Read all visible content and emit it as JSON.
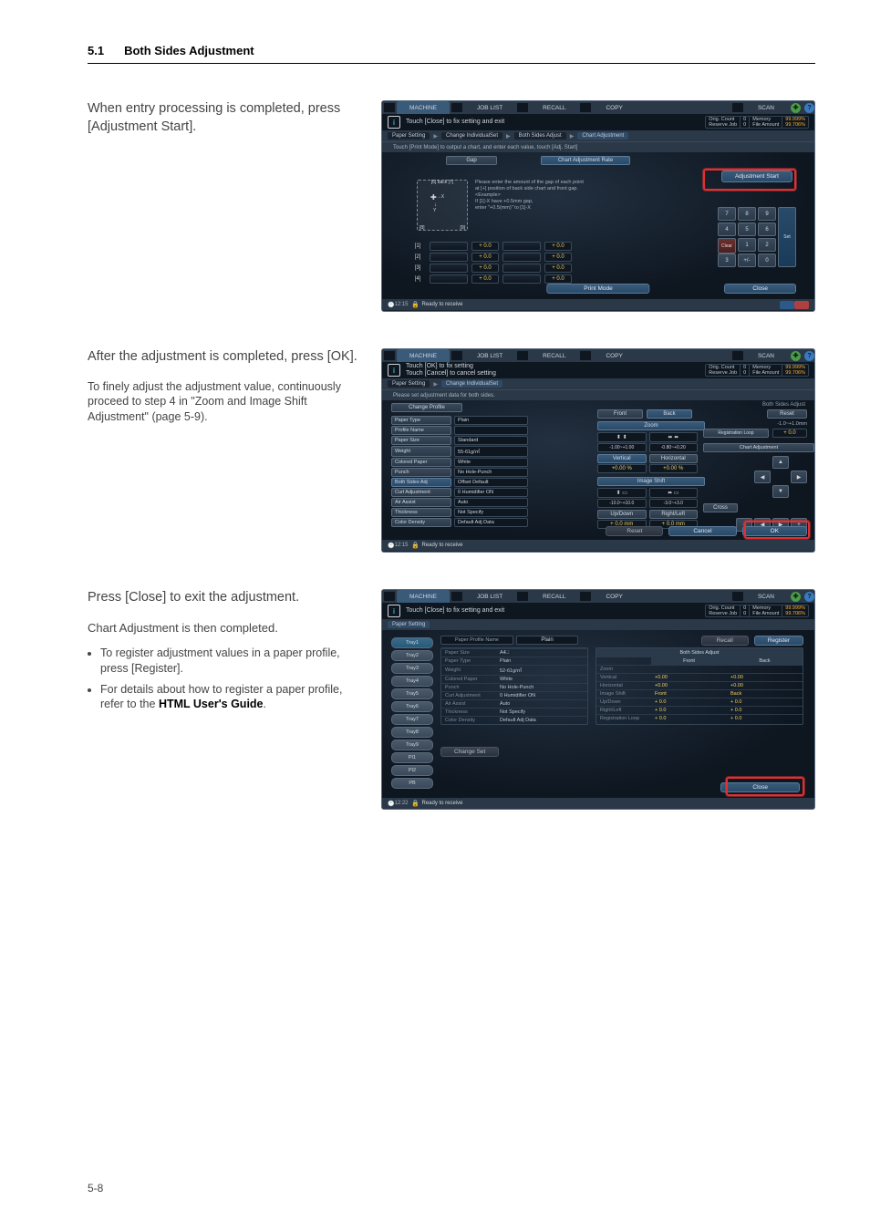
{
  "header": {
    "section": "5.1",
    "title": "Both Sides Adjustment"
  },
  "page_number": "5-8",
  "block1": {
    "lead": "When entry processing is completed, press [Adjustment Start].",
    "info_text": "Touch [Close] to fix setting and exit",
    "stats": {
      "orig_count_k": "Orig. Count",
      "orig_count_v": "0",
      "mem_k": "Memory",
      "mem_v": "99.999%",
      "res_k": "Reserve Job",
      "res_v": "0",
      "file_k": "File Amount",
      "file_v": "99.706%"
    },
    "crumb": {
      "a": "Paper Setting",
      "b": "Change IndividualSet",
      "c": "Both Sides Adjust",
      "d": "Chart Adjustment"
    },
    "tip": "Touch [Print Mode] to output a chart, and enter each value, touch [Adj. Start]",
    "tabs": {
      "gap": "Gap",
      "rate": "Chart Adjustment Rate"
    },
    "start_btn": "Adjustment Start",
    "diag_top": "[6] back [7]",
    "diag_bottom_l": "[8]",
    "diag_bottom_r": "[9]",
    "diag_text": "Please enter the amount of the gap of each point at [+] position of back side chart and front gap.\n<Example>\nIf [1]-X have +0.5mm gap,\nenter \"+0.5(mm)\" to [1]-X",
    "rows": [
      {
        "lab": "[1]",
        "vx": "+ 0.0",
        "vy": "+ 0.0"
      },
      {
        "lab": "[2]",
        "vx": "+ 0.0",
        "vy": "+ 0.0"
      },
      {
        "lab": "[3]",
        "vx": "+ 0.0",
        "vy": "+ 0.0"
      },
      {
        "lab": "[4]",
        "vx": "+ 0.0",
        "vy": "+ 0.0"
      }
    ],
    "print_mode": "Print Mode",
    "close": "Close",
    "keypad": [
      "7",
      "8",
      "9",
      "4",
      "5",
      "6",
      "1",
      "2",
      "3",
      "0",
      "+/-"
    ],
    "clear": "Clear",
    "set": "Set",
    "ts": "12:15",
    "ready": "Ready to receive"
  },
  "block2": {
    "lead": "After the adjustment is completed, press [OK].",
    "para": "To finely adjust the adjustment value, continuously proceed to step 4 in \"Zoom and Image Shift Adjustment\" (page 5-9).",
    "info_text": "Touch [OK] to fix setting\nTouch [Cancel] to cancel setting",
    "crumb": {
      "a": "Paper Setting",
      "b": "Change IndividualSet"
    },
    "tip": "Please set adjustment data for both sides.",
    "left_tabs": "Change Profile",
    "left_items": [
      [
        "Paper Type",
        "Plain"
      ],
      [
        "Profile Name",
        ""
      ],
      [
        "Paper Size",
        "Standard"
      ],
      [
        "Weight",
        "55-61g/㎡"
      ],
      [
        "Colored Paper",
        "White"
      ],
      [
        "Punch",
        "No Hole-Punch"
      ],
      [
        "Both Sides Adj",
        "Offset Default"
      ],
      [
        "Curl Adjustment",
        "0  Humidifier ON"
      ],
      [
        "Air Assist",
        "Auto"
      ],
      [
        "Thickness",
        "Not Specify"
      ],
      [
        "Color Density",
        "Default Adj Data"
      ]
    ],
    "right_header": "Both Sides Adjust",
    "front": "Front",
    "back": "Back",
    "reset": "Reset",
    "zoom": "Zoom",
    "range_z": "-1.0~+1.0mm",
    "reg": "Registration Loop",
    "reg_v": "+ 0.0",
    "vert": "Vertical",
    "horiz": "Horizontal",
    "zoom_vals": [
      "-1.00~+1.00",
      "-0.80~+0.20",
      "+0.00 %",
      "+0.00 %"
    ],
    "chart_adj": "Chart Adjustment",
    "img_shift": "Image Shift",
    "shift_vals": [
      "-10.0~+10.0",
      "-3.0~+3.0",
      "+ 0.0 mm",
      "+ 0.0 mm"
    ],
    "updown": "Up/Down",
    "rightleft": "Right/Left",
    "cross": "Cross",
    "arrows": [
      "▲",
      "◀",
      "▶",
      "▼"
    ],
    "minuskey": "−",
    "pluskey": "+",
    "cancel": "Cancel",
    "ok": "OK",
    "ts": "12:15",
    "ready": "Ready to receive"
  },
  "block3": {
    "lead": "Press [Close] to exit the adjustment.",
    "sub": "Chart Adjustment is then completed.",
    "bul1": "To register adjustment values in a paper profile, press [Register].",
    "bul2_a": "For details about how to register a paper profile, refer to the ",
    "bul2_b": "HTML User's Guide",
    "bul2_c": ".",
    "info_text": "Touch [Close] to fix setting and exit",
    "crumb_a": "Paper Setting",
    "recall": "Recall",
    "register": "Register",
    "trays": [
      "Tray1",
      "Tray2",
      "Tray3",
      "Tray4",
      "Tray5",
      "Tray6",
      "Tray7",
      "Tray8",
      "Tray9",
      "PI1",
      "PI2",
      "PB"
    ],
    "profile_name_k": "Paper Profile Name",
    "profile_name_v": "Plain",
    "left": [
      [
        "Paper Size",
        "A4□"
      ],
      [
        "Paper Type",
        "Plain"
      ],
      [
        "Weight",
        "52-61g/㎡"
      ],
      [
        "Colored Paper",
        "White"
      ],
      [
        "Punch",
        "No Hole-Punch"
      ],
      [
        "Curl Adjustment",
        "0  Humidifier ON"
      ],
      [
        "Air Assist",
        "Auto"
      ],
      [
        "Thickness",
        "Not Specify"
      ],
      [
        "Color Density",
        "Default Adj Data"
      ]
    ],
    "right_title": "Both Sides Adjust",
    "right_head": [
      "",
      "Front",
      "Back"
    ],
    "right": [
      [
        "Zoom",
        "",
        ""
      ],
      [
        "Vertical",
        "+0.00",
        "+0.00"
      ],
      [
        "Horizontal",
        "+0.00",
        "+0.00"
      ],
      [
        "Image Shift",
        "Front",
        "Back"
      ],
      [
        "Up/Down",
        "+ 0.0",
        "+ 0.0"
      ],
      [
        "Right/Left",
        "+ 0.0",
        "+ 0.0"
      ],
      [
        "Registration Loop",
        "+ 0.0",
        "+ 0.0"
      ]
    ],
    "change_set": "Change Set",
    "close": "Close",
    "ts": "12:22",
    "ready": "Ready to receive"
  },
  "topbar": {
    "machine": "MACHINE",
    "joblist": "JOB LIST",
    "recall": "RECALL",
    "copy": "COPY",
    "scan": "SCAN"
  }
}
